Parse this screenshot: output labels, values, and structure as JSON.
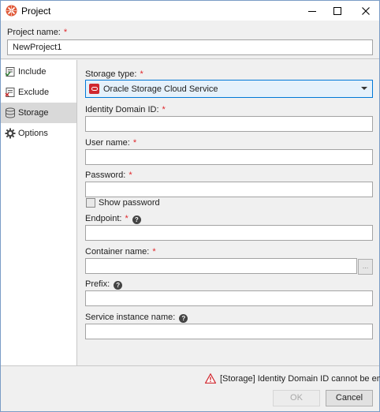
{
  "window": {
    "title": "Project",
    "controls": {
      "minimize": "minimize-icon",
      "maximize": "maximize-icon",
      "close": "close-icon"
    }
  },
  "project": {
    "name_label": "Project name:",
    "required_mark": "*",
    "name_value": "NewProject1"
  },
  "sidebar": {
    "items": [
      {
        "label": "Include",
        "icon": "include-icon",
        "selected": false
      },
      {
        "label": "Exclude",
        "icon": "exclude-icon",
        "selected": false
      },
      {
        "label": "Storage",
        "icon": "database-icon",
        "selected": true
      },
      {
        "label": "Options",
        "icon": "gear-icon",
        "selected": false
      }
    ]
  },
  "storage": {
    "type_label": "Storage type:",
    "type_value": "Oracle Storage Cloud Service",
    "identity_domain_label": "Identity Domain ID:",
    "identity_domain_value": "",
    "username_label": "User name:",
    "username_value": "",
    "password_label": "Password:",
    "password_value": "",
    "show_password_label": "Show password",
    "show_password_checked": false,
    "endpoint_label": "Endpoint:",
    "endpoint_value": "",
    "container_label": "Container name:",
    "container_value": "",
    "browse_label": "...",
    "prefix_label": "Prefix:",
    "prefix_value": "",
    "service_instance_label": "Service instance name:",
    "service_instance_value": ""
  },
  "footer": {
    "warning": "[Storage] Identity Domain ID cannot be empty",
    "ok_label": "OK",
    "cancel_label": "Cancel"
  },
  "colors": {
    "required": "#e0262a",
    "accent": "#0078d7",
    "warning": "#d0282f",
    "selected_item": "#d9d9d9"
  }
}
